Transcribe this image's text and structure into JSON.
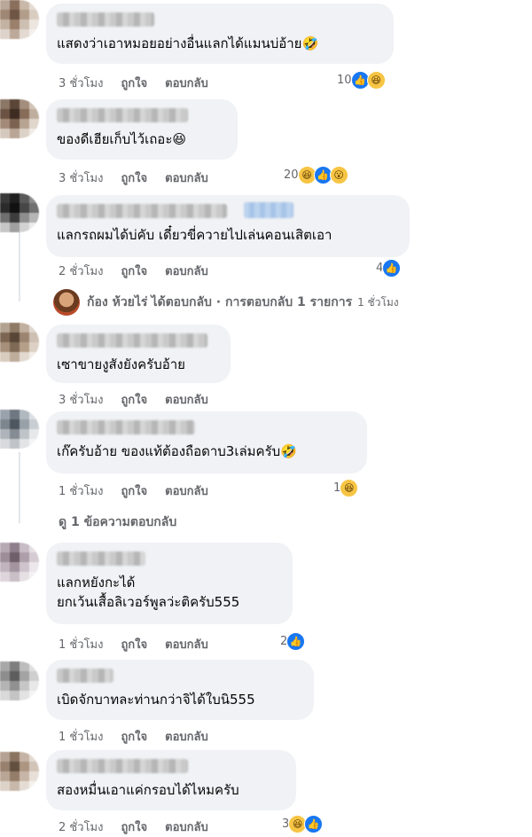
{
  "comments": [
    {
      "text": "แสดงว่าเอาหมอยอย่างอื่นแลกได้แมนบ่อ้าย🤣",
      "time": "3 ชั่วโมง",
      "like_label": "ถูกใจ",
      "reply_label": "ตอบกลับ",
      "reaction_count": "10",
      "reactions": [
        "like-icon",
        "haha-icon"
      ]
    },
    {
      "text": "ของดีเฮียเก็บไว้เถอะ😆",
      "time": "3 ชั่วโมง",
      "like_label": "ถูกใจ",
      "reply_label": "ตอบกลับ",
      "reaction_count": "20",
      "reactions": [
        "haha-icon",
        "like-icon",
        "wow-icon"
      ]
    },
    {
      "text": "แลกรถผมได้บ่คับ เดี๋ยวขี่ควายไปเล่นคอนเสิตเอา",
      "time": "2 ชั่วโมง",
      "like_label": "ถูกใจ",
      "reply_label": "ตอบกลับ",
      "reaction_count": "4",
      "reactions": [
        "like-icon"
      ]
    },
    {
      "text": "เซาขายงูสังยังครับอ้าย",
      "time": "3 ชั่วโมง",
      "like_label": "ถูกใจ",
      "reply_label": "ตอบกลับ",
      "reaction_count": "",
      "reactions": []
    },
    {
      "text": "เก๊ครับอ้าย ของแท้ต้องถือดาบ3เล่มครับ🤣",
      "time": "1 ชั่วโมง",
      "like_label": "ถูกใจ",
      "reply_label": "ตอบกลับ",
      "reaction_count": "1",
      "reactions": [
        "haha-icon"
      ]
    },
    {
      "text": "แลกหยังกะได้\nยกเว้นเสื้อลิเวอร์พูลว่ะติครับ555",
      "time": "1 ชั่วโมง",
      "like_label": "ถูกใจ",
      "reply_label": "ตอบกลับ",
      "reaction_count": "2",
      "reactions": [
        "like-icon"
      ]
    },
    {
      "text": "เบิดจักบาทละท่านกว่าจิได้ใบนิ555",
      "time": "1 ชั่วโมง",
      "like_label": "ถูกใจ",
      "reply_label": "ตอบกลับ",
      "reaction_count": "",
      "reactions": []
    },
    {
      "text": "สองหมื่นเอาแค่กรอบได้ไหมครับ",
      "time": "2 ชั่วโมง",
      "like_label": "ถูกใจ",
      "reply_label": "ตอบกลับ",
      "reaction_count": "3",
      "reactions": [
        "haha-icon",
        "like-icon"
      ]
    }
  ],
  "reply_summary": {
    "name": "ก้อง ห้วยไร่",
    "action": "ได้ตอบกลับ · การตอบกลับ 1 รายการ",
    "time": "1 ชั่วโมง"
  },
  "view_replies": "ดู 1 ข้อความตอบกลับ",
  "colors": {
    "bubble": "#f0f2f5",
    "meta_text": "#65676b",
    "like_blue": "#1877f2",
    "emoji_yellow": "#f7c544"
  }
}
